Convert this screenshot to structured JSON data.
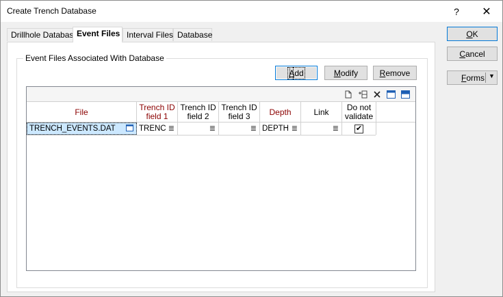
{
  "window": {
    "title": "Create Trench Database",
    "help_glyph": "?",
    "close_glyph": "✕"
  },
  "tabs": [
    {
      "label": "Drillhole Database"
    },
    {
      "label": "Event Files"
    },
    {
      "label": "Interval Files"
    },
    {
      "label": "Database"
    }
  ],
  "group": {
    "label": "Event Files Associated With Database"
  },
  "actions": {
    "add": {
      "pre": "",
      "key": "A",
      "post": "dd"
    },
    "modify": {
      "pre": "",
      "key": "M",
      "post": "odify"
    },
    "remove": {
      "pre": "",
      "key": "R",
      "post": "emove"
    }
  },
  "grid": {
    "toolbar_icons": [
      "new-row-icon",
      "insert-row-icon",
      "delete-icon",
      "window-icon",
      "panel-icon"
    ],
    "headers": {
      "file": "File",
      "trench1_l1": "Trench ID",
      "trench1_l2": "field 1",
      "trench2_l1": "Trench ID",
      "trench2_l2": "field 2",
      "trench3_l1": "Trench ID",
      "trench3_l2": "field 3",
      "depth": "Depth",
      "link": "Link",
      "dnv_l1": "Do not",
      "dnv_l2": "validate"
    },
    "row": {
      "file": "TRENCH_EVENTS.DAT",
      "trench1": "TRENC",
      "trench2": "",
      "trench3": "",
      "depth": "DEPTH",
      "link": "",
      "do_not_validate_mark": "✔"
    }
  },
  "side": {
    "ok": {
      "pre": "",
      "key": "O",
      "post": "K"
    },
    "cancel": {
      "pre": "",
      "key": "C",
      "post": "ancel"
    },
    "forms": {
      "pre": "",
      "key": "F",
      "post": "orms"
    },
    "forms_arrow": "▼"
  },
  "colors": {
    "required_header": "#8b0000",
    "selection": "#cce8ff",
    "focus_border": "#0078d7"
  }
}
